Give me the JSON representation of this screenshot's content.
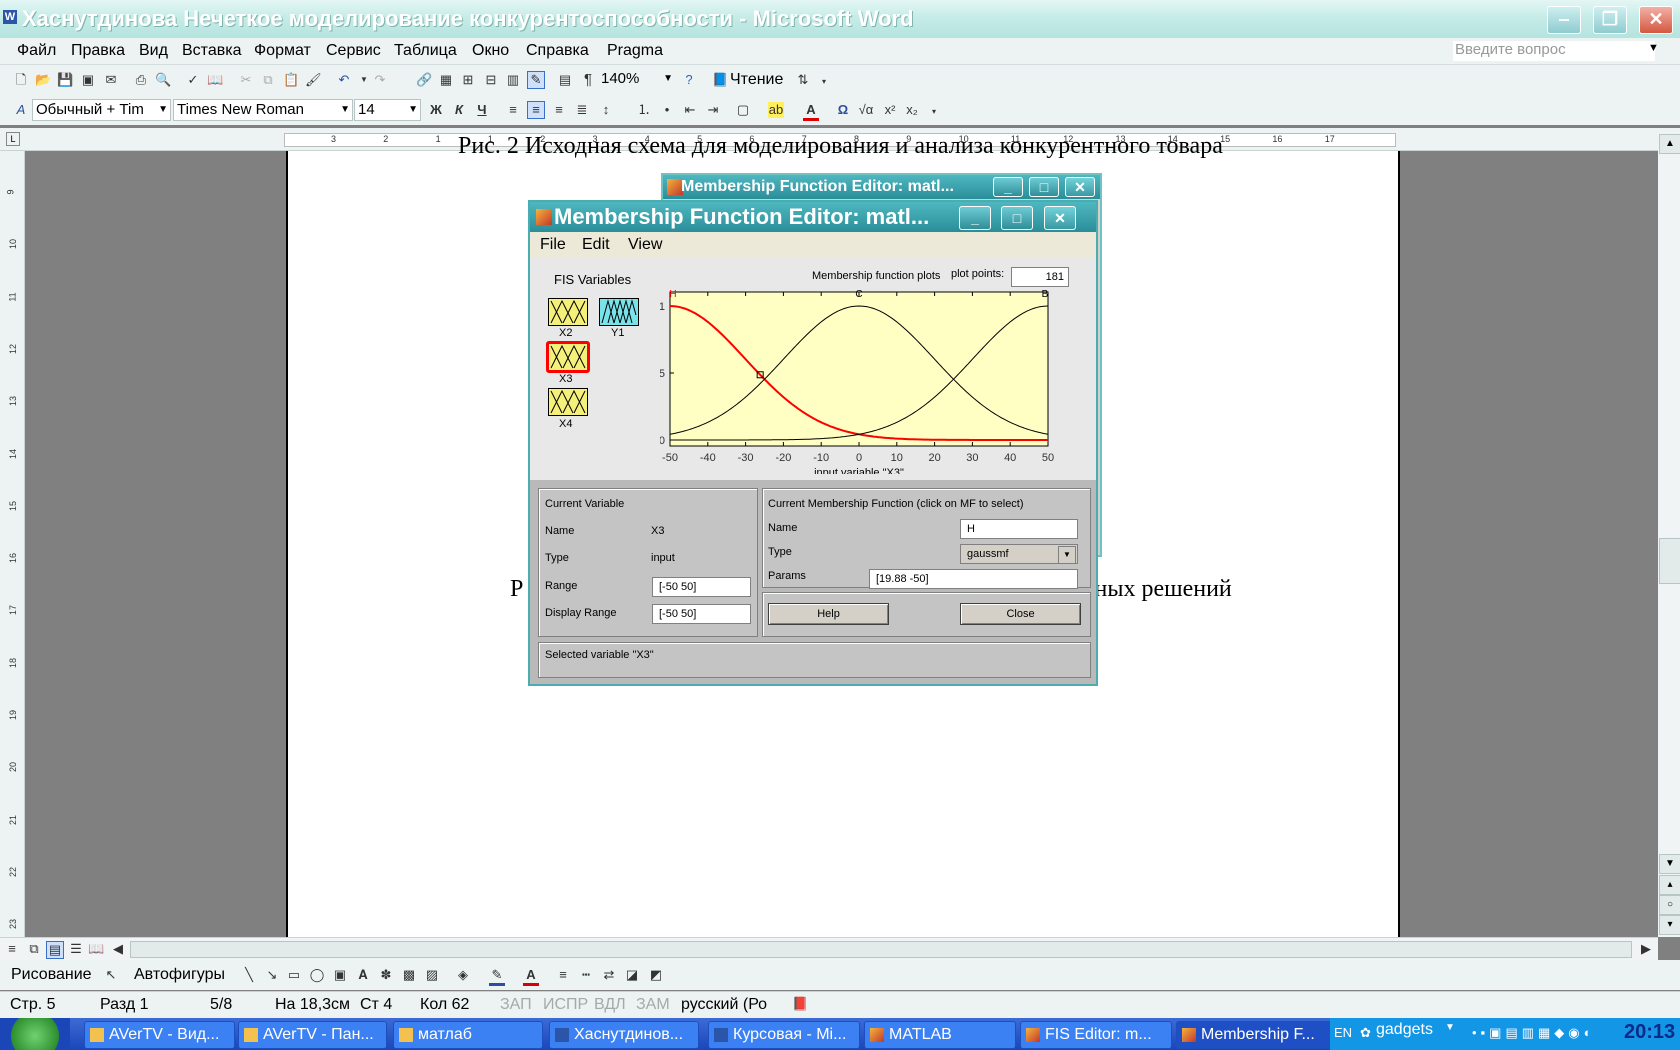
{
  "window": {
    "title": "Хаснутдинова Нечеткое моделирование конкурентоспособности - Microsoft Word",
    "app_icon": "W"
  },
  "menu": {
    "items": [
      "Файл",
      "Правка",
      "Вид",
      "Вставка",
      "Формат",
      "Сервис",
      "Таблица",
      "Окно",
      "Справка",
      "Pragma"
    ],
    "ask_placeholder": "Введите вопрос"
  },
  "toolbar": {
    "zoom": "140%",
    "reading_label": "Чтение",
    "style": "Обычный + Tim",
    "font": "Times New Roman",
    "font_size": "14"
  },
  "ruler": {
    "h_ticks": [
      "3",
      "2",
      "1",
      "1",
      "2",
      "3",
      "4",
      "5",
      "6",
      "7",
      "8",
      "9",
      "10",
      "11",
      "12",
      "13",
      "14",
      "15",
      "16",
      "17"
    ],
    "v_ticks": [
      "9",
      "10",
      "11",
      "12",
      "13",
      "14",
      "15",
      "16",
      "17",
      "18",
      "19",
      "20",
      "21",
      "22",
      "23"
    ]
  },
  "document": {
    "line_top": "Рис. 2 Исходная схема для моделирования и анализа конкурентного товара",
    "line_mid_left": "Р",
    "line_mid_right": "тных решений"
  },
  "back_dialog": {
    "title": "Membership Function Editor: matl..."
  },
  "dialog": {
    "title": "Membership Function Editor: matl...",
    "menu": [
      "File",
      "Edit",
      "View"
    ],
    "fis_label": "FIS Variables",
    "variables": [
      {
        "name": "X2",
        "color": "#f5f07a"
      },
      {
        "name": "Y1",
        "color": "#79e3ea"
      },
      {
        "name": "X3",
        "color": "#f5f07a"
      },
      {
        "name": "X4",
        "color": "#f5f07a"
      }
    ],
    "plot_title": "Membership function plots",
    "plot_points_label": "plot points:",
    "plot_points_value": "181",
    "current_variable_header": "Current Variable",
    "name_label": "Name",
    "name_value": "X3",
    "type_label": "Type",
    "type_value": "input",
    "range_label": "Range",
    "range_value": "[-50 50]",
    "display_range_label": "Display Range",
    "display_range_value": "[-50 50]",
    "mf_header": "Current Membership Function (click on MF to select)",
    "mf_name_label": "Name",
    "mf_name_value": "H",
    "mf_type_label": "Type",
    "mf_type_value": "gaussmf",
    "mf_params_label": "Params",
    "mf_params_value": "[19.88 -50]",
    "help_label": "Help",
    "close_label": "Close",
    "status": "Selected variable \"X3\""
  },
  "chart_data": {
    "type": "line",
    "xlabel": "input variable \"X3\"",
    "xlim": [
      -50,
      50
    ],
    "ylim": [
      0,
      1
    ],
    "x_ticks": [
      "-50",
      "-40",
      "-30",
      "-20",
      "-10",
      "0",
      "10",
      "20",
      "30",
      "40",
      "50"
    ],
    "y_ticks": [
      "0",
      "0.5",
      "1"
    ],
    "grid": false,
    "series": [
      {
        "name": "H",
        "mf": "gaussmf",
        "sigma": 19.88,
        "center": -50,
        "selected": true,
        "color": "#ff0000"
      },
      {
        "name": "C",
        "mf": "gaussmf",
        "sigma": 19.88,
        "center": 0,
        "selected": false,
        "color": "#000000"
      },
      {
        "name": "B",
        "mf": "gaussmf",
        "sigma": 19.88,
        "center": 50,
        "selected": false,
        "color": "#000000"
      }
    ]
  },
  "statusbar": {
    "page": "Стр. 5",
    "section": "Разд 1",
    "pages": "5/8",
    "at": "На 18,3см",
    "line": "Ст 4",
    "col": "Кол 62",
    "rec": "ЗАП",
    "trk": "ИСПР",
    "ext": "ВДЛ",
    "ovr": "ЗАМ",
    "lang": "русский (Ро"
  },
  "drawbar": {
    "draw": "Рисование",
    "autoshapes": "Автофигуры"
  },
  "taskbar": {
    "items": [
      "AVerTV - Вид...",
      "AVerTV - Пан...",
      "матлаб",
      "Хаснутдинов...",
      "Курсовая - Mi...",
      "MATLAB",
      "FIS Editor: m...",
      "Membership F..."
    ],
    "lang": "EN",
    "gadgets": "gadgets",
    "clock": "20:13"
  }
}
